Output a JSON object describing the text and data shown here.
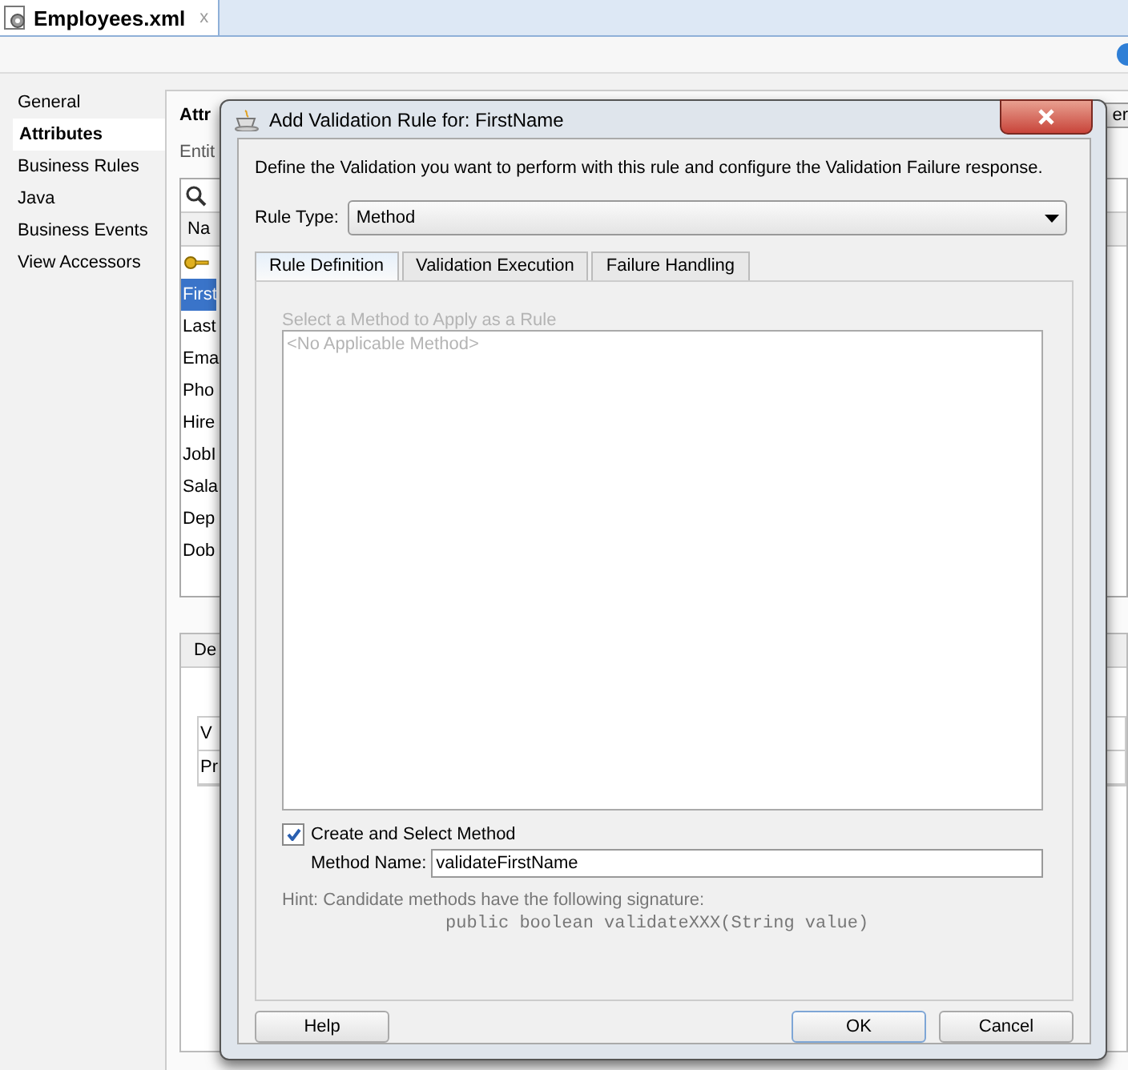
{
  "editor_tab": {
    "title": "Employees.xml",
    "close": "x"
  },
  "nav": [
    {
      "label": "General",
      "selected": false
    },
    {
      "label": "Attributes",
      "selected": true
    },
    {
      "label": "Business Rules",
      "selected": false
    },
    {
      "label": "Java",
      "selected": false
    },
    {
      "label": "Business Events",
      "selected": false
    },
    {
      "label": "View Accessors",
      "selected": false
    }
  ],
  "background": {
    "heading": "Attr",
    "subtitle": "Entit",
    "column_header": "Na",
    "button_edge": "er",
    "rows": [
      {
        "label": "First",
        "selected": true
      },
      {
        "label": "Last",
        "selected": false
      },
      {
        "label": "Ema",
        "selected": false
      },
      {
        "label": "Pho",
        "selected": false
      },
      {
        "label": "Hire",
        "selected": false
      },
      {
        "label": "JobI",
        "selected": false
      },
      {
        "label": "Sala",
        "selected": false
      },
      {
        "label": "Dep",
        "selected": false
      },
      {
        "label": "Dob",
        "selected": false
      }
    ],
    "detail_tab": "De",
    "detail_header": "V",
    "detail_row": "Pr"
  },
  "dialog": {
    "title": "Add Validation Rule for: FirstName",
    "description": "Define the Validation you want to perform with this rule and configure the Validation Failure response.",
    "rule_type": {
      "label": "Rule Type:",
      "value": "Method"
    },
    "tabs": [
      {
        "label": "Rule Definition",
        "selected": true
      },
      {
        "label": "Validation Execution",
        "selected": false
      },
      {
        "label": "Failure Handling",
        "selected": false
      }
    ],
    "method_list": {
      "label": "Select a Method to Apply as a Rule",
      "disabled": true,
      "items": [
        "<No Applicable Method>"
      ]
    },
    "create_method": {
      "label": "Create and Select Method",
      "checked": true
    },
    "method_name": {
      "label": "Method Name:",
      "value": "validateFirstName"
    },
    "hint": "Hint: Candidate methods have the following signature:",
    "signature": "public boolean validateXXX(String value)",
    "buttons": [
      {
        "label": "Help",
        "kind": "help",
        "default": false
      },
      {
        "label": "OK",
        "kind": "ok",
        "default": true
      },
      {
        "label": "Cancel",
        "kind": "cancel",
        "default": false
      }
    ]
  }
}
